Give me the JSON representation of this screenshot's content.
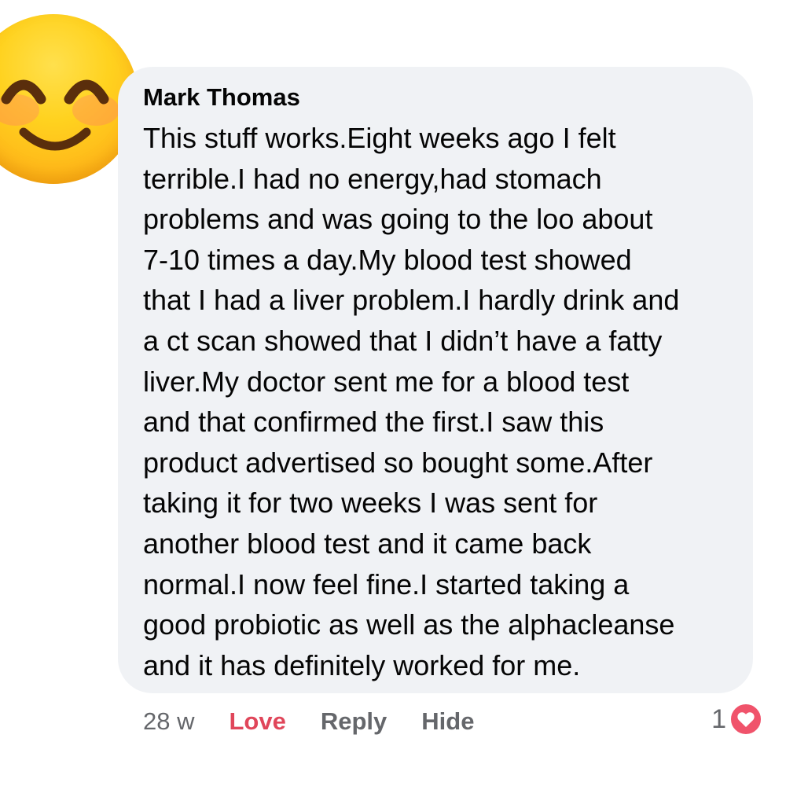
{
  "comment": {
    "author": "Mark Thomas",
    "avatar_icon": "smiling-face-emoji-icon",
    "text_lines": [
      "This stuff works.Eight weeks ago I felt",
      "terrible.I had no energy,had stomach",
      "problems and was going to the loo about",
      "7-10 times a day.My blood test showed",
      "that I had a liver problem.I hardly drink and",
      "a ct scan showed that I didn’t have a fatty",
      "liver.My doctor sent me for a blood test",
      "and that confirmed the first.I saw this",
      "product advertised so bought some.After",
      "taking it for two weeks I was sent for",
      "another blood test and it came back",
      "normal.I now feel fine.I started taking a",
      "good probiotic as well as the alphacleanse",
      "and it has definitely worked for me."
    ],
    "bubble_color": "#f0f2f5"
  },
  "actions": {
    "timestamp": "28 w",
    "love_label": "Love",
    "reply_label": "Reply",
    "hide_label": "Hide",
    "love_color": "#e0465a"
  },
  "reactions": {
    "count": "1",
    "icon": "heart-reaction-icon",
    "color": "#f0536b"
  }
}
